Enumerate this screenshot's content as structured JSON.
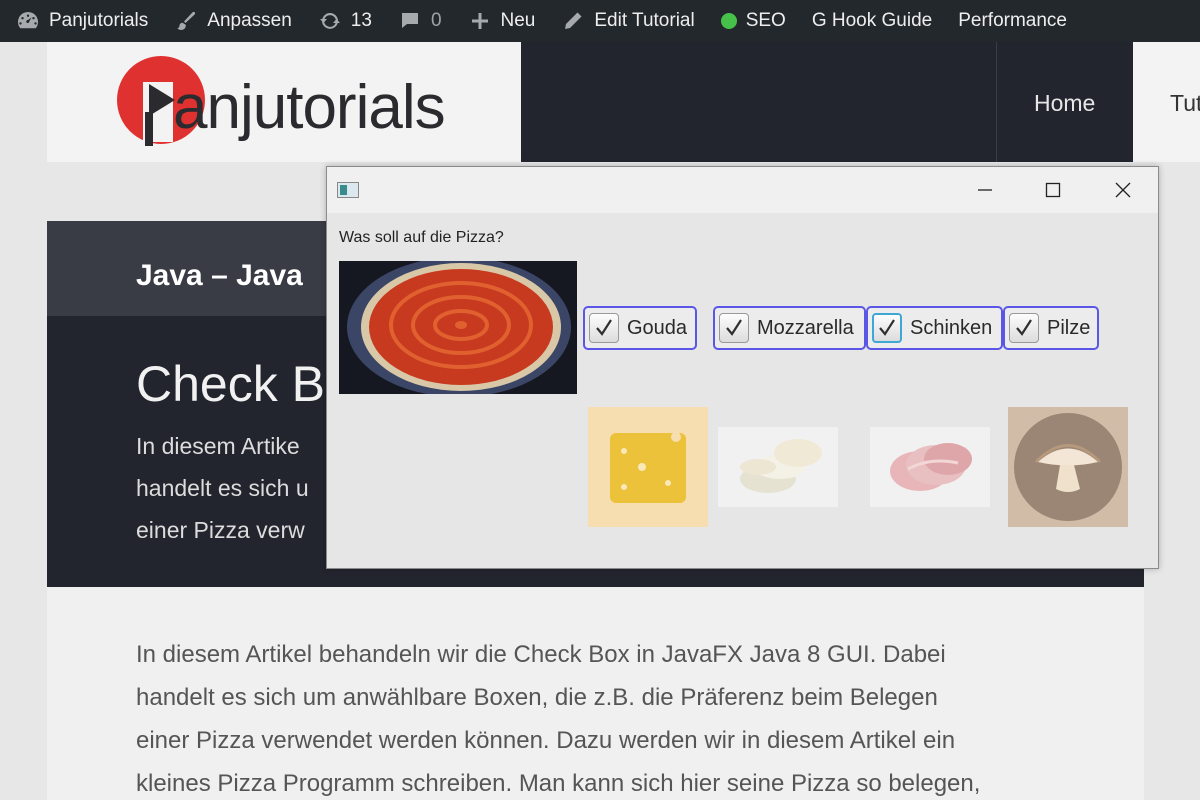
{
  "adminbar": {
    "site": "Panjutorials",
    "customize": "Anpassen",
    "updates": "13",
    "comments": "0",
    "new": "Neu",
    "edit": "Edit Tutorial",
    "seo": "SEO",
    "hook": "G Hook Guide",
    "performance": "Performance",
    "seo_color": "#46c24a"
  },
  "header": {
    "logo_text": "anjutorials",
    "nav": {
      "home": "Home",
      "tutorials": "Tut"
    },
    "brand_color": "#e03131"
  },
  "hero": {
    "breadcrumb": "Java – Java",
    "title": "Check B",
    "excerpt": [
      "In diesem Artike",
      "handelt es sich u",
      "einer Pizza verw"
    ]
  },
  "article": {
    "paragraph": [
      "In diesem Artikel behandeln wir die Check Box in JavaFX Java 8 GUI. Dabei",
      "handelt es sich um anwählbare Boxen, die z.B. die Präferenz beim Belegen",
      "einer Pizza verwendet werden können. Dazu werden wir in diesem Artikel ein",
      "kleines Pizza Programm schreiben. Man kann sich hier seine Pizza so belegen,"
    ]
  },
  "window": {
    "prompt": "Was soll auf die Pizza?",
    "checkboxes": [
      {
        "label": "Gouda",
        "checked": true
      },
      {
        "label": "Mozzarella",
        "checked": true
      },
      {
        "label": "Schinken",
        "checked": true,
        "focused": true
      },
      {
        "label": "Pilze",
        "checked": true
      }
    ],
    "focus_border_color": "#5a57e6"
  }
}
